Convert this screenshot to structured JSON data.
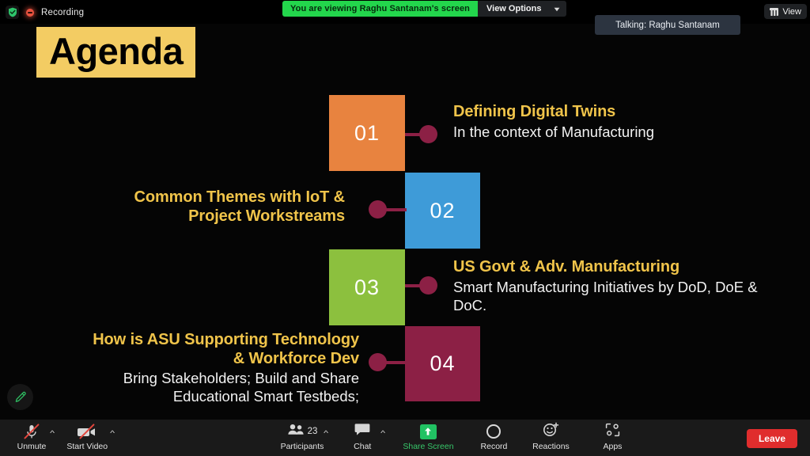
{
  "topbar": {
    "shield_icon": "shield-check-icon",
    "recording_icon": "recording-dot-icon",
    "recording_label": "Recording",
    "viewing_banner": "You are viewing Raghu Santanam's screen",
    "view_options_label": "View Options",
    "view_options_caret": "chevron-down-icon",
    "talking_label": "Talking: Raghu Santanam",
    "view_button_label": "View",
    "view_button_icon": "grid-view-icon"
  },
  "slide": {
    "title": "Agenda",
    "title_bg": "#f3cc63",
    "gold": "#f0c44a",
    "connector_color": "#8c2045",
    "items": [
      {
        "number": "01",
        "box_color": "#e8833f",
        "side": "right",
        "heading": "Defining Digital Twins",
        "subtext": "In the context of Manufacturing"
      },
      {
        "number": "02",
        "box_color": "#3e9bd8",
        "side": "left",
        "heading": "Common Themes with IoT & Project Workstreams",
        "subtext": ""
      },
      {
        "number": "03",
        "box_color": "#8cc03e",
        "side": "right",
        "heading": "US Govt & Adv. Manufacturing",
        "subtext": "Smart Manufacturing Initiatives by DoD, DoE & DoC."
      },
      {
        "number": "04",
        "box_color": "#8c2045",
        "side": "left",
        "heading": "How is ASU Supporting Technology & Workforce Dev",
        "subtext": "Bring Stakeholders; Build and Share Educational Smart Testbeds;"
      }
    ]
  },
  "annotate": {
    "icon": "pen-annotate-icon"
  },
  "toolbar": {
    "unmute_label": "Unmute",
    "unmute_icon": "microphone-muted-icon",
    "start_video_label": "Start Video",
    "start_video_icon": "video-camera-off-icon",
    "participants_label": "Participants",
    "participants_icon": "people-icon",
    "participants_count": "23",
    "chat_label": "Chat",
    "chat_icon": "chat-bubble-icon",
    "share_screen_label": "Share Screen",
    "share_screen_icon": "share-screen-arrow-icon",
    "record_label": "Record",
    "record_icon": "record-circle-icon",
    "reactions_label": "Reactions",
    "reactions_icon": "smiley-plus-icon",
    "apps_label": "Apps",
    "apps_icon": "apps-bracket-icon",
    "leave_label": "Leave",
    "caret_icon": "chevron-up-icon"
  }
}
